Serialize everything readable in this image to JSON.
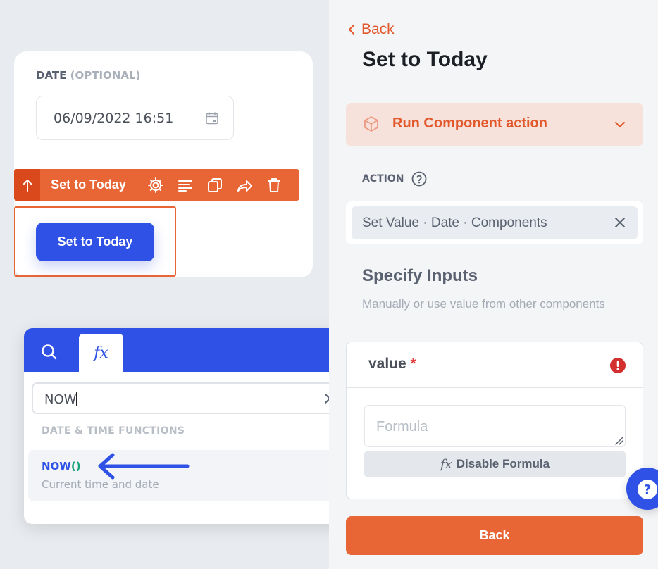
{
  "canvas": {
    "date_field": {
      "label": "DATE",
      "optional": "(OPTIONAL)",
      "value": "06/09/2022 16:51",
      "icon": "calendar-icon"
    },
    "toolbar": {
      "component_name": "Set to Today",
      "icons": [
        "arrow-up-icon",
        "gear-icon",
        "align-left-icon",
        "duplicate-icon",
        "share-icon",
        "trash-icon"
      ]
    },
    "button_label": "Set to Today"
  },
  "formula_popup": {
    "tabs": [
      "search-icon",
      "fx"
    ],
    "fx_label": "fx",
    "search_value": "NOW",
    "section_title": "DATE & TIME FUNCTIONS",
    "items": [
      {
        "name": "NOW",
        "parens": "()",
        "description": "Current time and date"
      }
    ]
  },
  "panel": {
    "back_link": "Back",
    "title": "Set to Today",
    "run_action": "Run Component action",
    "action_label": "ACTION",
    "action_value": "Set Value · Date · Components",
    "specify_title": "Specify Inputs",
    "specify_subtitle": "Manually or use value from other components",
    "input": {
      "name": "value",
      "required_mark": "*",
      "formula_placeholder": "Formula",
      "disable_fx": "fx",
      "disable_label": "Disable Formula"
    },
    "back_button": "Back",
    "help_fab": "?"
  },
  "colors": {
    "accent_orange": "#e86536",
    "primary_blue": "#2f51e5",
    "error_red": "#d32f2f"
  }
}
